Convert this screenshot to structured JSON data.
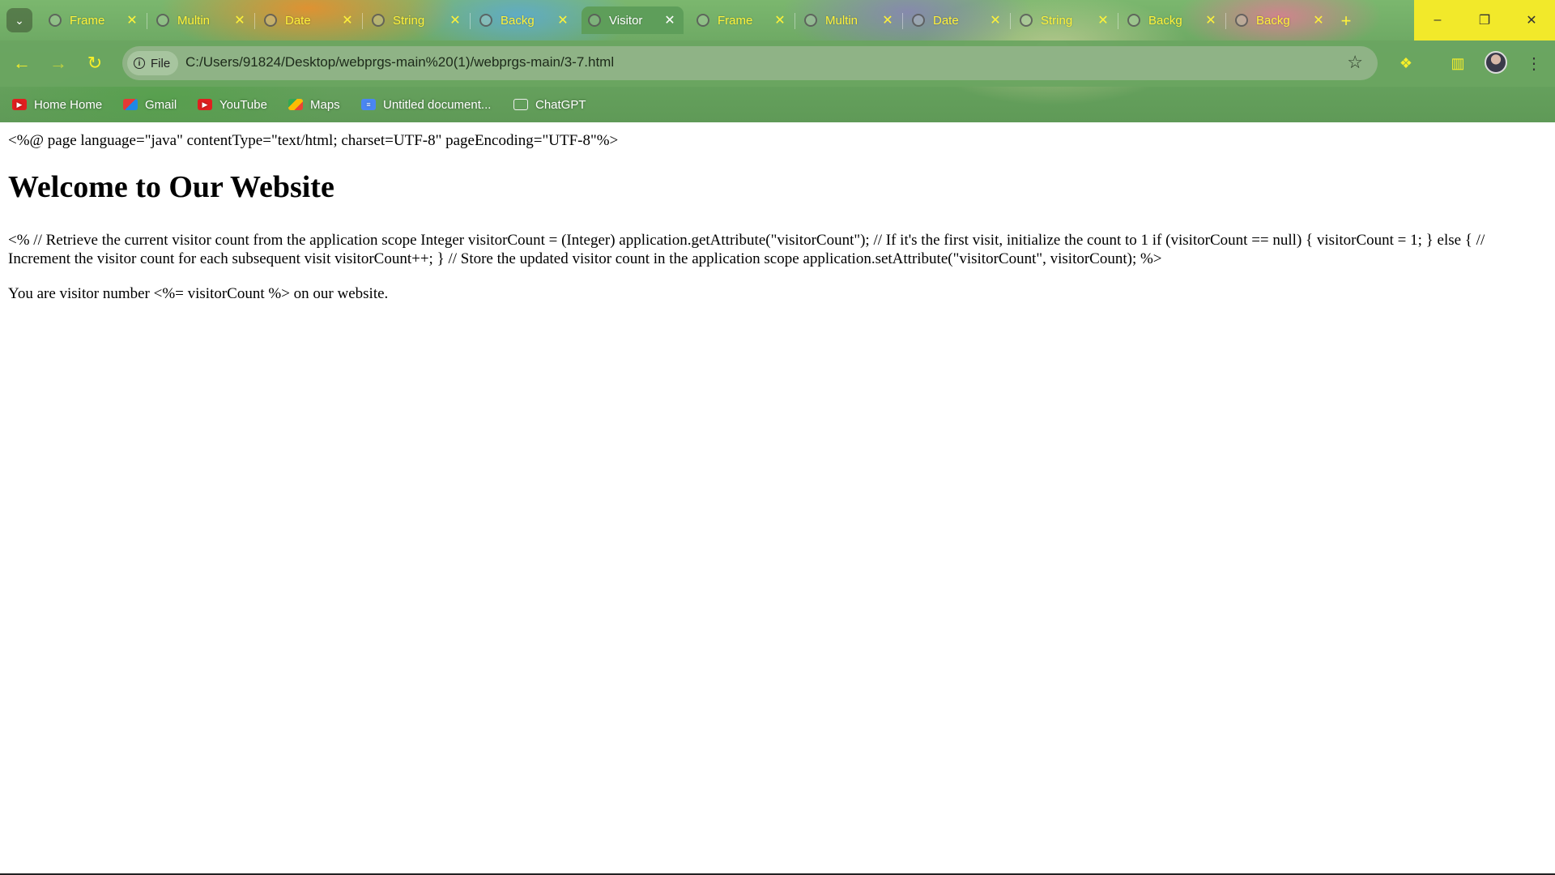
{
  "browser": {
    "tabs": [
      {
        "title": "Frame",
        "active": false
      },
      {
        "title": "Multin",
        "active": false
      },
      {
        "title": "Date",
        "active": false
      },
      {
        "title": "String",
        "active": false
      },
      {
        "title": "Backg",
        "active": false
      },
      {
        "title": "Visitor",
        "active": true
      },
      {
        "title": "Frame",
        "active": false
      },
      {
        "title": "Multin",
        "active": false
      },
      {
        "title": "Date",
        "active": false
      },
      {
        "title": "String",
        "active": false
      },
      {
        "title": "Backg",
        "active": false
      },
      {
        "title": "Backg",
        "active": false
      }
    ],
    "address_bar": {
      "scheme_label": "File",
      "url": "C:/Users/91824/Desktop/webprgs-main%20(1)/webprgs-main/3-7.html"
    },
    "bookmarks": [
      {
        "label": "Home Home",
        "icon": "youtube-icon"
      },
      {
        "label": "Gmail",
        "icon": "gmail-icon"
      },
      {
        "label": "YouTube",
        "icon": "youtube-icon"
      },
      {
        "label": "Maps",
        "icon": "maps-icon"
      },
      {
        "label": "Untitled document...",
        "icon": "docs-icon"
      },
      {
        "label": "ChatGPT",
        "icon": "chatgpt-icon"
      }
    ],
    "accent_color": "#f2e92a",
    "chrome_color": "#6aa561"
  },
  "page": {
    "directive": "<%@ page language=\"java\" contentType=\"text/html; charset=UTF-8\" pageEncoding=\"UTF-8\"%>",
    "heading": "Welcome to Our Website",
    "scriptlet": "<% // Retrieve the current visitor count from the application scope Integer visitorCount = (Integer) application.getAttribute(\"visitorCount\"); // If it's the first visit, initialize the count to 1 if (visitorCount == null) { visitorCount = 1; } else { // Increment the visitor count for each subsequent visit visitorCount++; } // Store the updated visitor count in the application scope application.setAttribute(\"visitorCount\", visitorCount); %>",
    "visitor_line": "You are visitor number <%= visitorCount %> on our website."
  }
}
